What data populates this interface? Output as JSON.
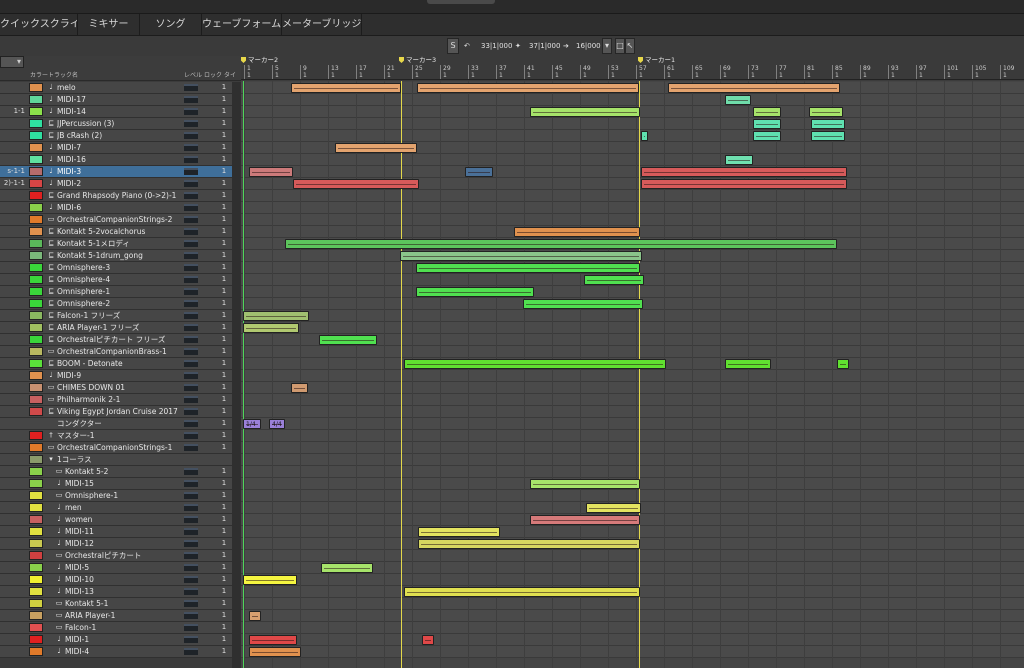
{
  "top_tabs": [
    {
      "label": "クイックスクライブ"
    },
    {
      "label": "ミキサー"
    },
    {
      "label": "ソング"
    },
    {
      "label": "ウェーブフォーム"
    },
    {
      "label": "メーターブリッジ"
    }
  ],
  "left_field_value": "▾",
  "transport": {
    "s_button": "S",
    "loop_start": "33|1|000",
    "loop_end": "37|1|000",
    "length": "16|000"
  },
  "list_headers": {
    "color": "カラー",
    "track_name": "トラック名",
    "level": "レベル",
    "lock": "ロック",
    "type": "タイ"
  },
  "markers": [
    {
      "label": "マーカー2"
    },
    {
      "label": "マーカー3"
    },
    {
      "label": "マーカー1"
    }
  ],
  "ruler_bars": [
    "1",
    "5",
    "9",
    "13",
    "17",
    "21",
    "25",
    "29",
    "33",
    "37",
    "41",
    "45",
    "49",
    "53",
    "57",
    "61",
    "65",
    "69",
    "73",
    "77",
    "81",
    "85",
    "89",
    "93",
    "97",
    "101",
    "105",
    "109"
  ],
  "ruler_sub": "1",
  "tracks": [
    {
      "loc": "",
      "name": "melo",
      "icon": "♩",
      "color": "#e0914e",
      "v": "1"
    },
    {
      "loc": "",
      "name": "MIDI-17",
      "icon": "♩",
      "color": "#5fd69a",
      "v": "1"
    },
    {
      "loc": "1-1",
      "name": "MIDI-14",
      "icon": "♩",
      "color": "#8be04a",
      "v": "1"
    },
    {
      "loc": "",
      "name": "JJPercussion (3)",
      "icon": "⊑",
      "color": "#2fe0a0",
      "v": "1"
    },
    {
      "loc": "",
      "name": "JB cRash (2)",
      "icon": "⊑",
      "color": "#2fe0a0",
      "v": "1"
    },
    {
      "loc": "",
      "name": "MIDI-7",
      "icon": "♩",
      "color": "#e0914e",
      "v": "1"
    },
    {
      "loc": "",
      "name": "MIDI-16",
      "icon": "♩",
      "color": "#5fe0a0",
      "v": "1"
    },
    {
      "loc": "s-1-1",
      "name": "MIDI-3",
      "icon": "♩",
      "color": "#b56b6b",
      "v": "1",
      "selected": true
    },
    {
      "loc": "2)-1-1",
      "name": "MIDI-2",
      "icon": "♩",
      "color": "#d64545",
      "v": "1"
    },
    {
      "loc": "",
      "name": "Grand Rhapsody Piano (0->2)-1",
      "icon": "⊑",
      "color": "#e02020",
      "v": "1"
    },
    {
      "loc": "",
      "name": "MIDI-6",
      "icon": "♩",
      "color": "#8ad04a",
      "v": "1"
    },
    {
      "loc": "",
      "name": "OrchestralCompanionStrings-2",
      "icon": "▭",
      "color": "#e07a2a",
      "v": "1"
    },
    {
      "loc": "",
      "name": "Kontakt 5-2vocalchorus",
      "icon": "⊑",
      "color": "#e0914e",
      "v": "1"
    },
    {
      "loc": "",
      "name": "Kontakt 5-1メロディ",
      "icon": "⊑",
      "color": "#5ab85a",
      "v": "1"
    },
    {
      "loc": "",
      "name": "Kontakt 5-1drum_gong",
      "icon": "⊑",
      "color": "#7ab87a",
      "v": "1"
    },
    {
      "loc": "",
      "name": "Omnisphere-3",
      "icon": "⊑",
      "color": "#3ad63a",
      "v": "1"
    },
    {
      "loc": "",
      "name": "Omnisphere-4",
      "icon": "⊑",
      "color": "#3ad63a",
      "v": "1"
    },
    {
      "loc": "",
      "name": "Omnisphere-1",
      "icon": "⊑",
      "color": "#3ad63a",
      "v": "1"
    },
    {
      "loc": "",
      "name": "Omnisphere-2",
      "icon": "⊑",
      "color": "#3ad63a",
      "v": "1"
    },
    {
      "loc": "",
      "name": "Falcon-1 フリーズ",
      "icon": "⊑",
      "color": "#8ab860",
      "v": "1"
    },
    {
      "loc": "",
      "name": "ARIA Player-1 フリーズ",
      "icon": "⊑",
      "color": "#a0c060",
      "v": "1"
    },
    {
      "loc": "",
      "name": "Orchestralピチカート フリーズ",
      "icon": "⊑",
      "color": "#3ad63a",
      "v": "1"
    },
    {
      "loc": "",
      "name": "OrchestralCompanionBrass-1",
      "icon": "▭",
      "color": "#b8b860",
      "v": "1"
    },
    {
      "loc": "",
      "name": "BOOM - Detonate",
      "icon": "⊑",
      "color": "#5ae03a",
      "v": "1"
    },
    {
      "loc": "",
      "name": "MIDI-9",
      "icon": "♩",
      "color": "#e0914e",
      "v": "1"
    },
    {
      "loc": "",
      "name": "CHIMES DOWN 01",
      "icon": "▭",
      "color": "#c89070",
      "v": "1"
    },
    {
      "loc": "",
      "name": "Philharmonik 2-1",
      "icon": "▭",
      "color": "#c86060",
      "v": "1"
    },
    {
      "loc": "",
      "name": "Viking Egypt  Jordan Cruise 2017",
      "icon": "⊑",
      "color": "#d04a4a",
      "v": "1"
    },
    {
      "loc": "",
      "name": "コンダクター",
      "icon": "",
      "color": "",
      "v": "1"
    },
    {
      "loc": "",
      "name": "マスター-1",
      "icon": "†",
      "color": "#e02020",
      "v": "1"
    },
    {
      "loc": "",
      "name": "OrchestralCompanionStrings-1",
      "icon": "▭",
      "color": "#e07a2a",
      "v": "1"
    },
    {
      "loc": "",
      "name": "1コーラス",
      "icon": "▾",
      "color": "#8a9a6a",
      "v": "",
      "folder": true
    },
    {
      "loc": "",
      "name": "Kontakt 5-2",
      "icon": "▭",
      "color": "#8ad04a",
      "v": "1",
      "indent": true
    },
    {
      "loc": "",
      "name": "MIDI-15",
      "icon": "♩",
      "color": "#8ad04a",
      "v": "1",
      "indent": true
    },
    {
      "loc": "",
      "name": "Omnisphere-1",
      "icon": "▭",
      "color": "#e0e040",
      "v": "1",
      "indent": true
    },
    {
      "loc": "",
      "name": "men",
      "icon": "♩",
      "color": "#e0e040",
      "v": "1",
      "indent": true
    },
    {
      "loc": "",
      "name": "women",
      "icon": "♩",
      "color": "#c86060",
      "v": "1",
      "indent": true
    },
    {
      "loc": "",
      "name": "MIDI-11",
      "icon": "♩",
      "color": "#e0e040",
      "v": "1",
      "indent": true
    },
    {
      "loc": "",
      "name": "MIDI-12",
      "icon": "♩",
      "color": "#c8c850",
      "v": "1",
      "indent": true
    },
    {
      "loc": "",
      "name": "Orchestralピチカート",
      "icon": "▭",
      "color": "#d04040",
      "v": "1",
      "indent": true
    },
    {
      "loc": "",
      "name": "MIDI-5",
      "icon": "♩",
      "color": "#8ad04a",
      "v": "1",
      "indent": true
    },
    {
      "loc": "",
      "name": "MIDI-10",
      "icon": "♩",
      "color": "#f0f030",
      "v": "1",
      "indent": true
    },
    {
      "loc": "",
      "name": "MIDI-13",
      "icon": "♩",
      "color": "#e0e040",
      "v": "1",
      "indent": true
    },
    {
      "loc": "",
      "name": "Kontakt 5-1",
      "icon": "▭",
      "color": "#d0d040",
      "v": "1",
      "indent": true
    },
    {
      "loc": "",
      "name": "ARIA Player-1",
      "icon": "▭",
      "color": "#c8a060",
      "v": "1",
      "indent": true
    },
    {
      "loc": "",
      "name": "Falcon-1",
      "icon": "▭",
      "color": "#e05050",
      "v": "1",
      "indent": true
    },
    {
      "loc": "",
      "name": "MIDI-1",
      "icon": "♩",
      "color": "#e02020",
      "v": "1",
      "indent": true
    },
    {
      "loc": "",
      "name": "MIDI-4",
      "icon": "♩",
      "color": "#e07a2a",
      "v": "1",
      "indent": true
    }
  ],
  "conductor_labels": [
    "1/4",
    "4/4"
  ],
  "colors": {
    "marker_line": "#e3d84b",
    "start_line": "#4fd65a",
    "selected_row": "#3f6f9a"
  }
}
